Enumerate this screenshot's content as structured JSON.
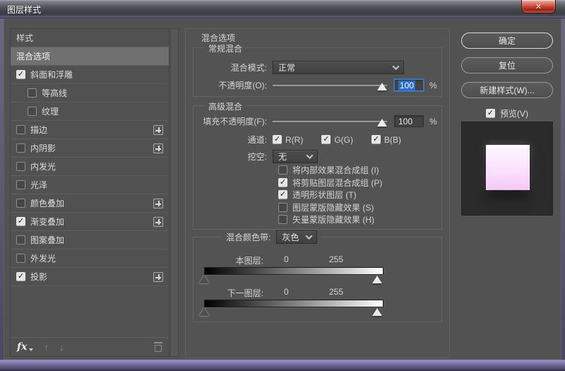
{
  "window": {
    "title": "图层样式",
    "close_glyph": "✕"
  },
  "icons": {
    "check": "✓",
    "arrow_up": "↑",
    "arrow_down": "↓",
    "fx": "fx"
  },
  "sidebar": {
    "header": "样式",
    "selected_item": "混合选项",
    "items": [
      {
        "label": "斜面和浮雕",
        "checked": true,
        "indent": false,
        "plus": false
      },
      {
        "label": "等高线",
        "checked": false,
        "indent": true,
        "plus": false
      },
      {
        "label": "纹理",
        "checked": false,
        "indent": true,
        "plus": false
      },
      {
        "label": "描边",
        "checked": false,
        "indent": false,
        "plus": true
      },
      {
        "label": "内阴影",
        "checked": false,
        "indent": false,
        "plus": true
      },
      {
        "label": "内发光",
        "checked": false,
        "indent": false,
        "plus": false
      },
      {
        "label": "光泽",
        "checked": false,
        "indent": false,
        "plus": false
      },
      {
        "label": "颜色叠加",
        "checked": false,
        "indent": false,
        "plus": true
      },
      {
        "label": "渐变叠加",
        "checked": true,
        "indent": false,
        "plus": true
      },
      {
        "label": "图案叠加",
        "checked": false,
        "indent": false,
        "plus": false
      },
      {
        "label": "外发光",
        "checked": false,
        "indent": false,
        "plus": false
      },
      {
        "label": "投影",
        "checked": true,
        "indent": false,
        "plus": true
      }
    ]
  },
  "main": {
    "title": "混合选项",
    "general": {
      "legend": "常规混合",
      "blend_mode_label": "混合模式:",
      "blend_mode_value": "正常",
      "opacity_label": "不透明度(O):",
      "opacity_value": "100",
      "percent": "%"
    },
    "advanced": {
      "legend": "高级混合",
      "fill_opacity_label": "填充不透明度(F):",
      "fill_opacity_value": "100",
      "percent": "%",
      "channels_label": "通道:",
      "channels": [
        {
          "label": "R(R)",
          "checked": true
        },
        {
          "label": "G(G)",
          "checked": true
        },
        {
          "label": "B(B)",
          "checked": true
        }
      ],
      "knockout_label": "挖空:",
      "knockout_value": "无",
      "options": [
        {
          "label": "将内部效果混合成组 (I)",
          "checked": false
        },
        {
          "label": "将剪贴图层混合成组 (P)",
          "checked": true
        },
        {
          "label": "透明形状图层 (T)",
          "checked": true
        },
        {
          "label": "图层蒙版隐藏效果 (S)",
          "checked": false
        },
        {
          "label": "矢量蒙版隐藏效果 (H)",
          "checked": false
        }
      ]
    },
    "blend_if": {
      "label": "混合颜色带:",
      "value": "灰色",
      "this_layer": {
        "label": "本图层:",
        "min": "0",
        "max": "255"
      },
      "underlying_layer": {
        "label": "下一图层:",
        "min": "0",
        "max": "255"
      }
    }
  },
  "actions": {
    "ok": "确定",
    "reset": "复位",
    "new_style": "新建样式(W)...",
    "preview_label": "预览(V)",
    "preview_checked": true
  },
  "colors": {
    "dialog_bg": "#525252",
    "selection_blue": "#2a6cc9",
    "preview_pink": "#f8dcfa",
    "close_red": "#bd4132"
  }
}
